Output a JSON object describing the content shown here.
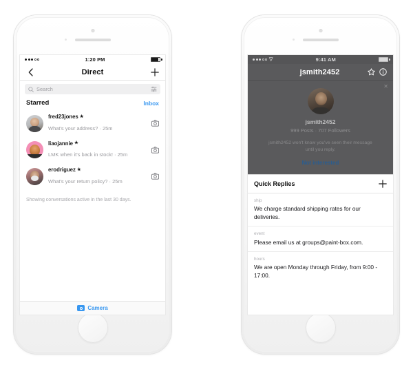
{
  "left_phone": {
    "status_bar": {
      "carrier_signal": "•••○○",
      "time": "1:20 PM"
    },
    "nav": {
      "back_icon": "chevron-left-icon",
      "title": "Direct",
      "add_icon": "plus-icon"
    },
    "search": {
      "placeholder": "Search",
      "icon": "search-icon",
      "filter_icon": "sliders-icon"
    },
    "section": {
      "title": "Starred",
      "link": "Inbox"
    },
    "conversations": [
      {
        "name": "fred23jones",
        "starred": "★",
        "snippet": "What's your address? · 25m",
        "action_icon": "camera-icon"
      },
      {
        "name": "liaojannie",
        "starred": "★",
        "snippet": "LMK when it's back in stock! · 25m",
        "action_icon": "camera-icon"
      },
      {
        "name": "erodriguez",
        "starred": "★",
        "snippet": "What's your return policy? · 25m",
        "action_icon": "camera-icon"
      }
    ],
    "note": "Showing conversations active in the last 30 days.",
    "bottom_bar": {
      "label": "Camera",
      "icon": "camera-icon"
    }
  },
  "right_phone": {
    "status_bar": {
      "carrier_signal": "•••○○",
      "wifi_icon": "wifi-icon",
      "time": "9:41 AM"
    },
    "nav": {
      "title": "jsmith2452",
      "star_icon": "star-outline-icon",
      "info_icon": "info-circle-icon"
    },
    "profile": {
      "close_icon": "close-icon",
      "avatar": "user-avatar",
      "username": "jsmith2452",
      "stats": "999 Posts · 707 Followers",
      "note": "jsmith2452 won't know you've seen their message until you reply.",
      "action": "Not interested"
    },
    "quick_replies": {
      "title": "Quick Replies",
      "add_icon": "plus-icon",
      "items": [
        {
          "shortcut": "ship",
          "message": "We charge standard shipping rates for our deliveries."
        },
        {
          "shortcut": "event",
          "message": "Please email us at groups@paint-box.com."
        },
        {
          "shortcut": "hours",
          "message": "We are open Monday through Friday, from 9:00 - 17:00."
        }
      ]
    }
  },
  "colors": {
    "accent_blue": "#3897f0",
    "link_dim_blue": "#2a5d8f",
    "dim_overlay": "#5a5a5c"
  }
}
